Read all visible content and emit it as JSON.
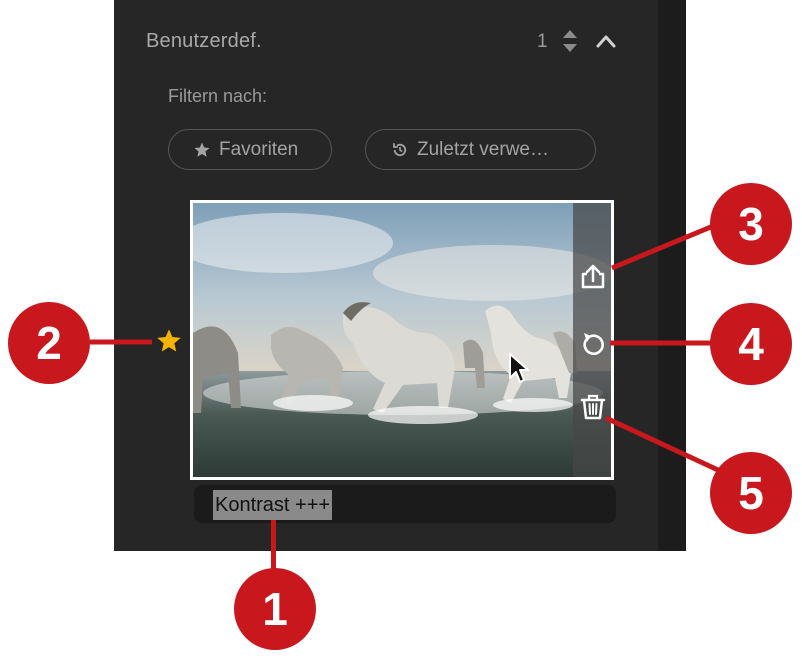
{
  "section": {
    "title": "Benutzerdef.",
    "count": "1",
    "stepper_icon": "updown-stepper-icon",
    "collapse_icon": "chevron-up-icon"
  },
  "filter": {
    "label": "Filtern nach:",
    "chips": [
      {
        "label": "Favoriten",
        "icon": "star-icon"
      },
      {
        "label": "Zuletzt verwe…",
        "icon": "recent-history-icon"
      }
    ]
  },
  "preset": {
    "name": "Kontrast +++",
    "favorite": true,
    "actions": [
      {
        "icon": "share-icon"
      },
      {
        "icon": "reset-icon"
      },
      {
        "icon": "trash-icon"
      }
    ]
  },
  "callouts": [
    "1",
    "2",
    "3",
    "4",
    "5"
  ],
  "colors": {
    "panel": "#262626",
    "callout": "#c8171d",
    "star": "#f4b400"
  }
}
